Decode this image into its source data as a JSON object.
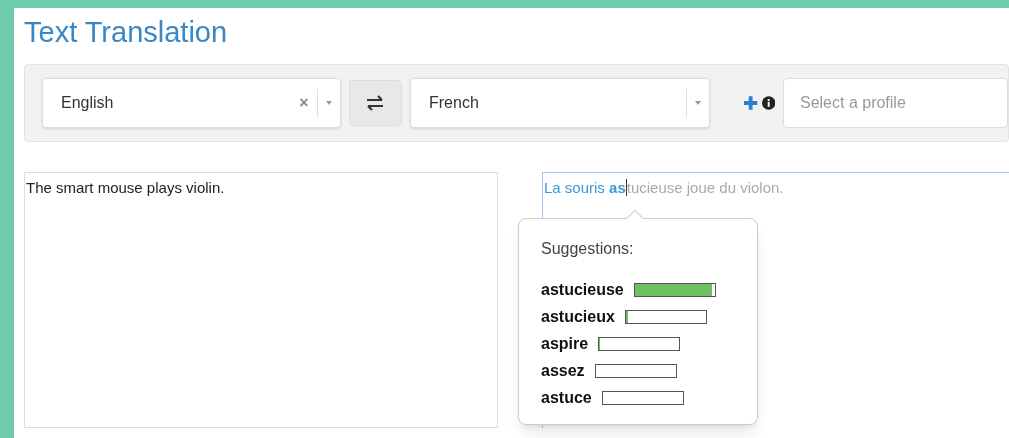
{
  "title": "Text Translation",
  "toolbar": {
    "source_language": {
      "value": "English"
    },
    "clear_icon": "×",
    "target_language": {
      "value": "French"
    },
    "profile": {
      "placeholder": "Select a profile"
    }
  },
  "source_text": "The smart mouse plays violin.",
  "translation": {
    "accepted": "La souris ",
    "typed": "as",
    "pending": "tucieuse joue du violon."
  },
  "suggestions": {
    "heading": "Suggestions:",
    "items": [
      {
        "word": "astucieuse",
        "level": 0.97
      },
      {
        "word": "astucieux",
        "level": 0.03
      },
      {
        "word": "aspire",
        "level": 0.01
      },
      {
        "word": "assez",
        "level": 0
      },
      {
        "word": "astuce",
        "level": 0
      }
    ]
  }
}
